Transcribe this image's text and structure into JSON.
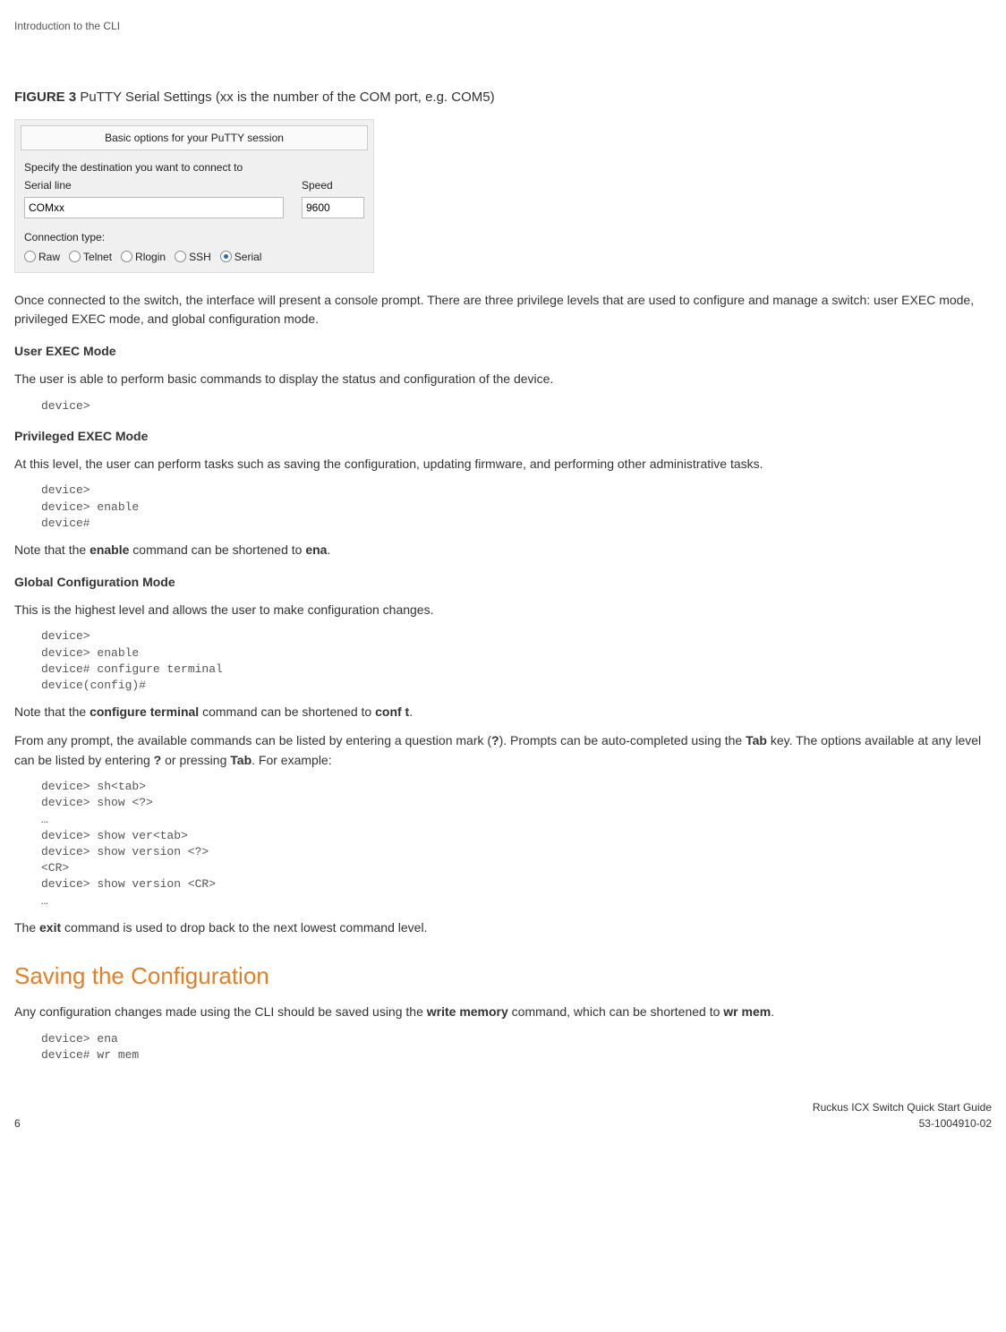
{
  "header": "Introduction to the CLI",
  "figure": {
    "label": "FIGURE 3",
    "caption": "PuTTY Serial Settings (xx is the number of the COM port, e.g. COM5)"
  },
  "putty": {
    "title": "Basic options for your PuTTY session",
    "destLabel": "Specify the destination you want to connect to",
    "serialLineLabel": "Serial line",
    "speedLabel": "Speed",
    "serialLineValue": "COMxx",
    "speedValue": "9600",
    "connTypeLabel": "Connection type:",
    "radios": [
      "Raw",
      "Telnet",
      "Rlogin",
      "SSH",
      "Serial"
    ],
    "selectedRadio": "Serial"
  },
  "para1": "Once connected to the switch, the interface will present a console prompt. There are three privilege levels that are used to configure and manage a switch: user EXEC mode, privileged EXEC mode, and global configuration mode.",
  "userExec": {
    "heading": "User EXEC Mode",
    "text": "The user is able to perform basic commands to display the status and configuration of the device.",
    "code": "device>"
  },
  "privExec": {
    "heading": "Privileged EXEC Mode",
    "text": "At this level, the user can perform tasks such as saving the configuration, updating firmware, and performing other administrative tasks.",
    "code": "device>\ndevice> enable\ndevice#",
    "noteBefore": "Note that the ",
    "noteB1": "enable",
    "noteMid": " command can be shortened to ",
    "noteB2": "ena",
    "noteAfter": "."
  },
  "globalConf": {
    "heading": "Global Configuration Mode",
    "text": "This is the highest level and allows the user to make configuration changes.",
    "code": "device>\ndevice> enable\ndevice# configure terminal\ndevice(config)#",
    "noteBefore": "Note that the ",
    "noteB1": "configure terminal",
    "noteMid": " command can be shortened to ",
    "noteB2": "conf t",
    "noteAfter": "."
  },
  "helpPara": {
    "p1a": "From any prompt, the available commands can be listed by entering a question mark (",
    "p1q": "?",
    "p1b": "). Prompts can be auto-completed using the ",
    "p1tab": "Tab",
    "p1c": " key. The options available at any level can be listed by entering ",
    "p1q2": "?",
    "p1d": " or pressing ",
    "p1tab2": "Tab",
    "p1e": ". For example:",
    "code": "device> sh<tab>\ndevice> show <?>\n…\ndevice> show ver<tab>\ndevice> show version <?>\n<CR>\ndevice> show version <CR>\n…"
  },
  "exitPara": {
    "before": "The ",
    "bold": "exit",
    "after": " command is used to drop back to the next lowest command level."
  },
  "savingHeading": "Saving the Configuration",
  "savingPara": {
    "a": "Any configuration changes made using the CLI should be saved using the ",
    "b1": "write memory",
    "b": " command, which can be shortened to ",
    "b2": "wr mem",
    "c": "."
  },
  "savingCode": "device> ena\ndevice# wr mem",
  "footer": {
    "pageNum": "6",
    "title": "Ruckus ICX Switch Quick Start Guide",
    "docNum": "53-1004910-02"
  }
}
